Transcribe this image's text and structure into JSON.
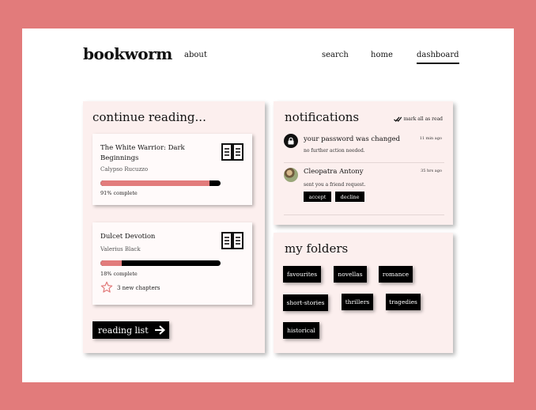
{
  "brand": {
    "name": "bookworm"
  },
  "nav": {
    "about": "about",
    "search": "search",
    "home": "home",
    "dashboard": "dashboard",
    "active": "dashboard"
  },
  "continue_reading": {
    "title": "continue reading...",
    "books": [
      {
        "title": "The White Warrior: Dark Beginnings",
        "author": "Calypso Rucuzzo",
        "progress": 0.91,
        "progress_label": "91% complete",
        "icon": "open-book-icon"
      },
      {
        "title": "Dulcet Devotion",
        "author": "Valerius Black",
        "progress": 0.18,
        "progress_label": "18% complete",
        "icon": "open-book-icon",
        "new_chapters": "3 new chapters"
      }
    ],
    "reading_list_button": "reading list"
  },
  "notifications": {
    "title": "notifications",
    "mark_all": "mark all as read",
    "items": [
      {
        "title": "your password was changed",
        "subtitle": "no further action needed.",
        "time": "11 min ago",
        "icon": "lock-icon"
      },
      {
        "title": "Cleopatra Antony",
        "subtitle": "sent you a friend request.",
        "time": "35 hrs ago",
        "icon": "avatar",
        "actions": [
          "accept",
          "decline"
        ]
      }
    ]
  },
  "folders": {
    "title": "my folders",
    "items": [
      "favourites",
      "novellas",
      "romance",
      "short-stories",
      "thrillers",
      "tragedies",
      "historical"
    ]
  },
  "colors": {
    "accent": "#e27b7b",
    "panel": "#fcefee",
    "dark": "#000000"
  }
}
